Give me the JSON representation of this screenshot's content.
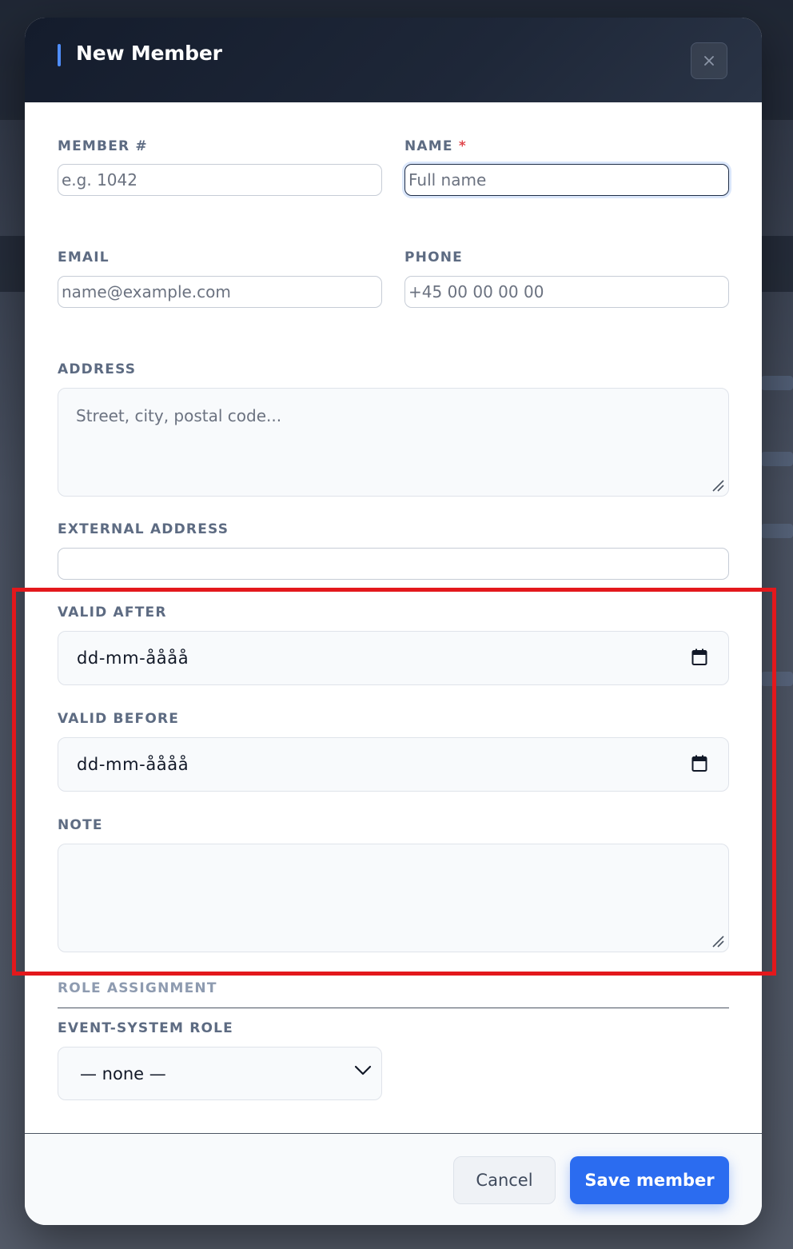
{
  "dialog": {
    "title": "New Member",
    "close_label": "×"
  },
  "form": {
    "member_number": {
      "label": "MEMBER #",
      "placeholder": "e.g. 1042",
      "value": ""
    },
    "name": {
      "label": "NAME",
      "required_marker": "*",
      "placeholder": "Full name",
      "value": ""
    },
    "email": {
      "label": "EMAIL",
      "placeholder": "name@example.com",
      "value": ""
    },
    "phone": {
      "label": "PHONE",
      "placeholder": "+45 00 00 00 00",
      "value": ""
    },
    "address": {
      "label": "ADDRESS",
      "placeholder": "Street, city, postal code..."
    },
    "external_address": {
      "label": "EXTERNAL ADDRESS",
      "value": ""
    },
    "valid_after": {
      "label": "VALID AFTER",
      "display": "dd-mm-åååå"
    },
    "valid_before": {
      "label": "VALID BEFORE",
      "display": "dd-mm-åååå"
    },
    "note": {
      "label": "NOTE",
      "placeholder": ""
    },
    "role_assignment": {
      "heading": "ROLE ASSIGNMENT",
      "event_system_role": {
        "label": "EVENT-SYSTEM ROLE",
        "selected": "— none —"
      }
    }
  },
  "footer": {
    "cancel_label": "Cancel",
    "save_label": "Save member"
  },
  "colors": {
    "accent": "#2b6cf0",
    "header_bg": "#141c2c",
    "required": "#e0474c",
    "highlight": "#e3181c"
  },
  "icons": {
    "close": "close-icon",
    "calendar": "calendar-icon",
    "resize": "resize-handle-icon",
    "select_arrow": "chevron-down-icon"
  }
}
